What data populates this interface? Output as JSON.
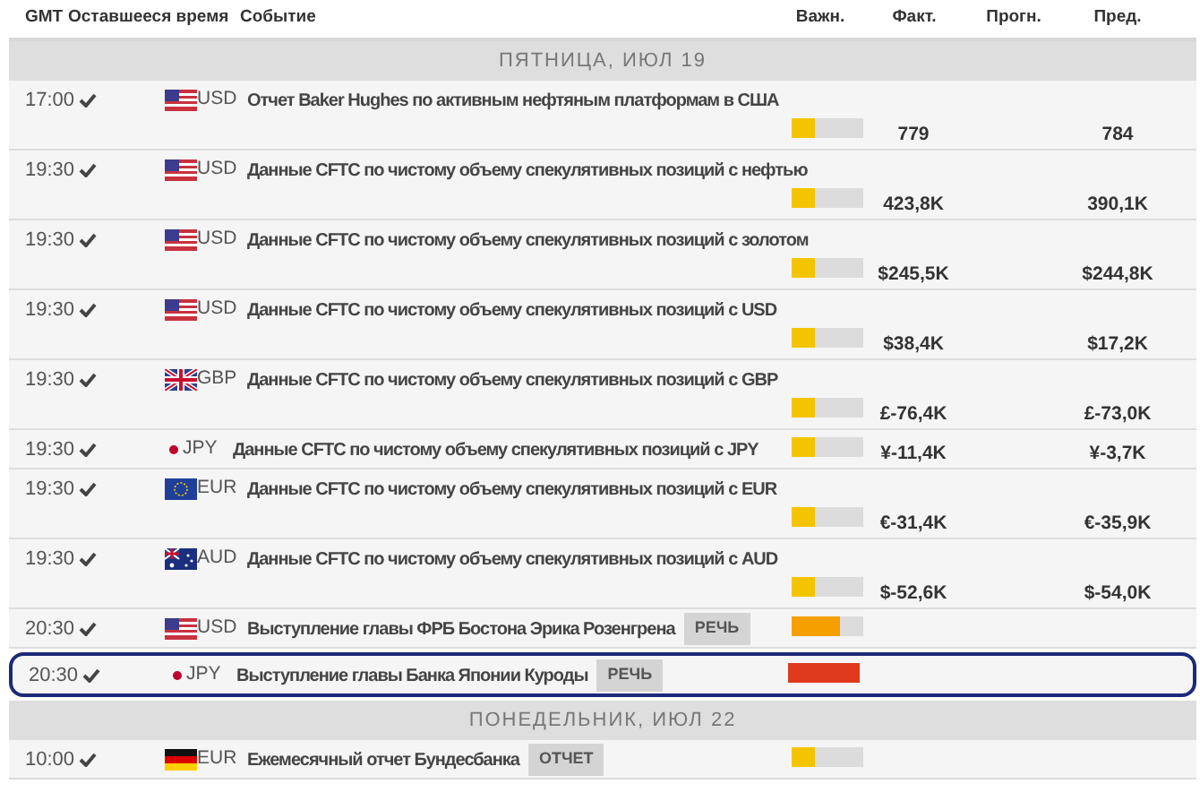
{
  "columns": [
    "GMT",
    "Оставшееся время",
    "Событие",
    "Важн.",
    "Факт.",
    "Прогн.",
    "Пред."
  ],
  "days": [
    {
      "label": "ПЯТНИЦА, ИЮЛ 19",
      "events": [
        {
          "time": "17:00",
          "kind": "us",
          "currency": "USD",
          "title": "Отчет Baker Hughes по активным нефтяным платформам в США",
          "importance": {
            "level": 0.33,
            "color": "#f5c400"
          },
          "actual": "779",
          "previous": "784",
          "selected": false
        },
        {
          "time": "19:30",
          "kind": "us",
          "currency": "USD",
          "title": "Данные CFTC по чистому объему спекулятивных позиций с нефтью",
          "importance": {
            "level": 0.33,
            "color": "#f5c400"
          },
          "actual": "423,8K",
          "previous": "390,1K",
          "selected": false
        },
        {
          "time": "19:30",
          "kind": "us",
          "currency": "USD",
          "title": "Данные CFTC по чистому объему спекулятивных позиций с золотом",
          "importance": {
            "level": 0.33,
            "color": "#f5c400"
          },
          "actual": "$245,5K",
          "previous": "$244,8K",
          "selected": false
        },
        {
          "time": "19:30",
          "kind": "us",
          "currency": "USD",
          "title": "Данные CFTC по чистому объему спекулятивных позиций с USD",
          "importance": {
            "level": 0.33,
            "color": "#f5c400"
          },
          "actual": "$38,4K",
          "previous": "$17,2K",
          "selected": false
        },
        {
          "time": "19:30",
          "kind": "gb",
          "currency": "GBP",
          "title": "Данные CFTC по чистому объему спекулятивных позиций с GBP",
          "importance": {
            "level": 0.33,
            "color": "#f5c400"
          },
          "actual": "£-76,4K",
          "previous": "£-73,0K",
          "selected": false
        },
        {
          "time": "19:30",
          "kind": "jp",
          "currency": "JPY",
          "title": "Данные CFTC по чистому объему спекулятивных позиций с JPY",
          "importance": {
            "level": 0.33,
            "color": "#f5c400"
          },
          "actual": "¥-11,4K",
          "previous": "¥-3,7K",
          "selected": false
        },
        {
          "time": "19:30",
          "kind": "eu",
          "currency": "EUR",
          "title": "Данные CFTC по чистому объему спекулятивных позиций с EUR",
          "importance": {
            "level": 0.33,
            "color": "#f5c400"
          },
          "actual": "€-31,4K",
          "previous": "€-35,9K",
          "selected": false
        },
        {
          "time": "19:30",
          "kind": "au",
          "currency": "AUD",
          "title": "Данные CFTC по чистому объему спекулятивных позиций с AUD",
          "importance": {
            "level": 0.33,
            "color": "#f5c400"
          },
          "actual": "$-52,6K",
          "previous": "$-54,0K",
          "selected": false
        },
        {
          "time": "20:30",
          "kind": "us",
          "currency": "USD",
          "title": "Выступление главы ФРБ Бостона Эрика Розенгрена",
          "badge": "РЕЧЬ",
          "importance": {
            "level": 0.67,
            "color": "#f5a000"
          },
          "selected": false
        },
        {
          "time": "20:30",
          "kind": "jp",
          "currency": "JPY",
          "title": "Выступление главы Банка Японии Куроды",
          "badge": "РЕЧЬ",
          "importance": {
            "level": 1,
            "color": "#e03a1e"
          },
          "selected": true
        }
      ]
    },
    {
      "label": "ПОНЕДЕЛЬНИК, ИЮЛ 22",
      "events": [
        {
          "time": "10:00",
          "kind": "de",
          "currency": "EUR",
          "title": "Ежемесячный отчет Бундесбанка",
          "badge": "ОТЧЕТ",
          "importance": {
            "level": 0.33,
            "color": "#f5c400"
          },
          "selected": false
        }
      ]
    }
  ]
}
